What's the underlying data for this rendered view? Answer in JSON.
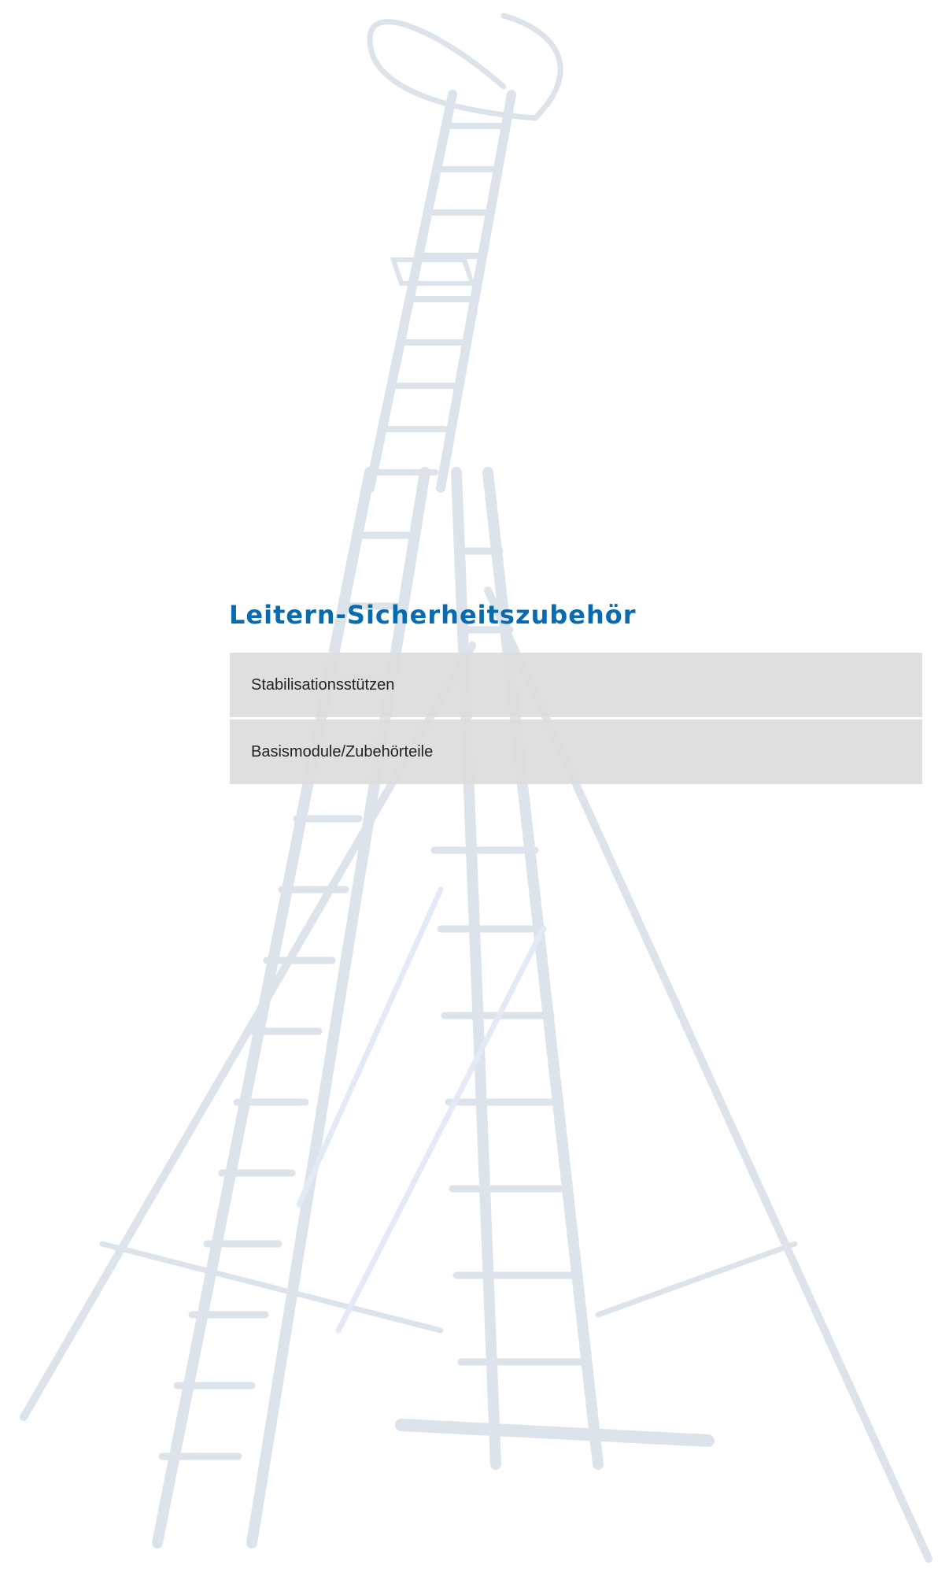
{
  "page": {
    "title": "Leitern-Sicherheitszubehör",
    "accent_color": "#0a6ab0",
    "menu_background": "#dddddd"
  },
  "menu": {
    "items": [
      {
        "label": "Stabilisationsstützen"
      },
      {
        "label": "Basismodule/Zubehörteile"
      }
    ]
  },
  "illustration": {
    "subject": "ladder-with-stabilizers-image"
  }
}
